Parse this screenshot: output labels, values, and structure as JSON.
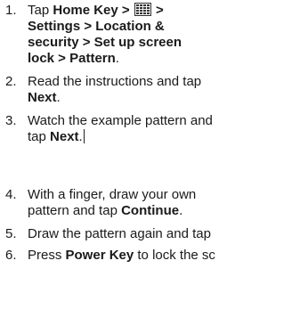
{
  "steps": [
    {
      "number": "1.",
      "tap": "Tap",
      "home_key": "Home Key >",
      "after_icon": ">",
      "icon": "grid-menu-icon",
      "line2": "Settings > Location &",
      "line3": "security > Set up screen",
      "line4": "lock > Pattern",
      "period": "."
    },
    {
      "number": "2.",
      "line1": "Read the instructions and tap",
      "bold": "Next",
      "period": "."
    },
    {
      "number": "3.",
      "line1": "Watch the example pattern and",
      "pre": "tap",
      "bold": "Next",
      "period": "."
    },
    {
      "number": "4.",
      "line1": "With a finger, draw your own",
      "pre": "pattern and tap",
      "bold": "Continue",
      "period": "."
    },
    {
      "number": "5.",
      "line1": "Draw the pattern again and tap"
    },
    {
      "number": "6.",
      "pre": "Press",
      "bold": "Power Key",
      "post": "to lock the sc"
    }
  ]
}
